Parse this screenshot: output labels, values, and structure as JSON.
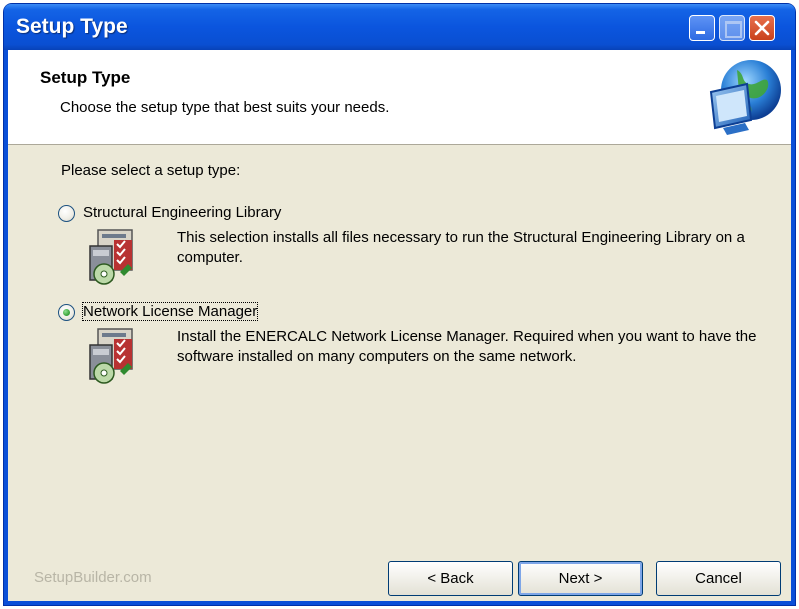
{
  "window": {
    "title": "Setup Type"
  },
  "header": {
    "title": "Setup Type",
    "subtitle": "Choose the setup type that best suits your needs.",
    "icon": "computer-globe-icon"
  },
  "prompt": "Please select a setup type:",
  "options": [
    {
      "label": "Structural Engineering Library",
      "description": "This selection installs all files necessary to run the Structural Engineering Library on a computer.",
      "selected": false,
      "icon": "install-package-icon"
    },
    {
      "label": "Network License Manager",
      "description": "Install the ENERCALC Network License Manager. Required when you want to have the software installed on many computers on the same network.",
      "selected": true,
      "icon": "install-package-icon"
    }
  ],
  "footer": {
    "brand": "SetupBuilder.com",
    "back_label": "< Back",
    "next_label": "Next >",
    "cancel_label": "Cancel"
  },
  "colors": {
    "titlebar": "#0a4fd8",
    "dialog_bg": "#ece9d8",
    "header_bg": "#ffffff"
  }
}
